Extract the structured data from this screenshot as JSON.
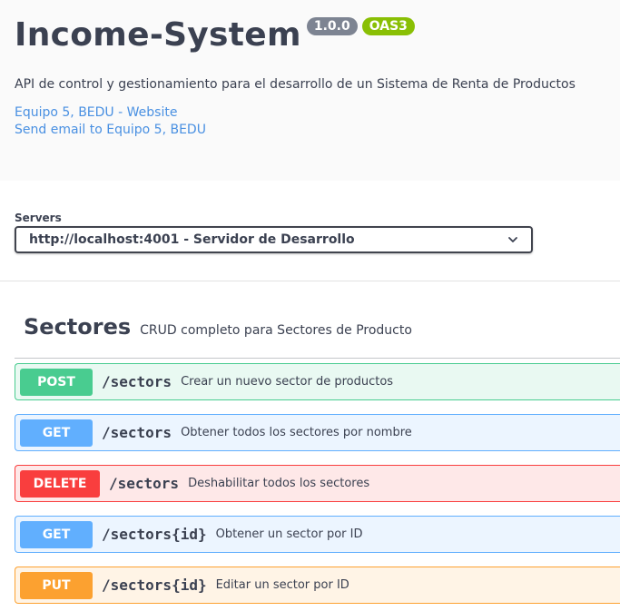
{
  "info": {
    "title": "Income-System",
    "version": "1.0.0",
    "oas_badge": "OAS3",
    "description": "API de control y gestionamiento para el desarrollo de un Sistema de Renta de Productos",
    "links": [
      "Equipo 5, BEDU - Website",
      "Send email to Equipo 5, BEDU"
    ]
  },
  "servers": {
    "label": "Servers",
    "selected": "http://localhost:4001 - Servidor de Desarrollo"
  },
  "tag": {
    "name": "Sectores",
    "description": "CRUD completo para Sectores de Producto"
  },
  "operations": [
    {
      "method": "POST",
      "path": "/sectors",
      "summary": "Crear un nuevo sector de productos"
    },
    {
      "method": "GET",
      "path": "/sectors",
      "summary": "Obtener todos los sectores por nombre"
    },
    {
      "method": "DELETE",
      "path": "/sectors",
      "summary": "Deshabilitar todos los sectores"
    },
    {
      "method": "GET",
      "path": "/sectors{id}",
      "summary": "Obtener un sector por ID"
    },
    {
      "method": "PUT",
      "path": "/sectors{id}",
      "summary": "Editar un sector por ID"
    }
  ],
  "colors": {
    "post": "#49cc90",
    "get": "#61affe",
    "delete": "#f93e3e",
    "put": "#fca130",
    "link": "#4990e2",
    "oas_badge": "#89bf04",
    "version_badge": "#7d8492"
  },
  "icons": {
    "server_dropdown": "chevron-down-icon"
  }
}
